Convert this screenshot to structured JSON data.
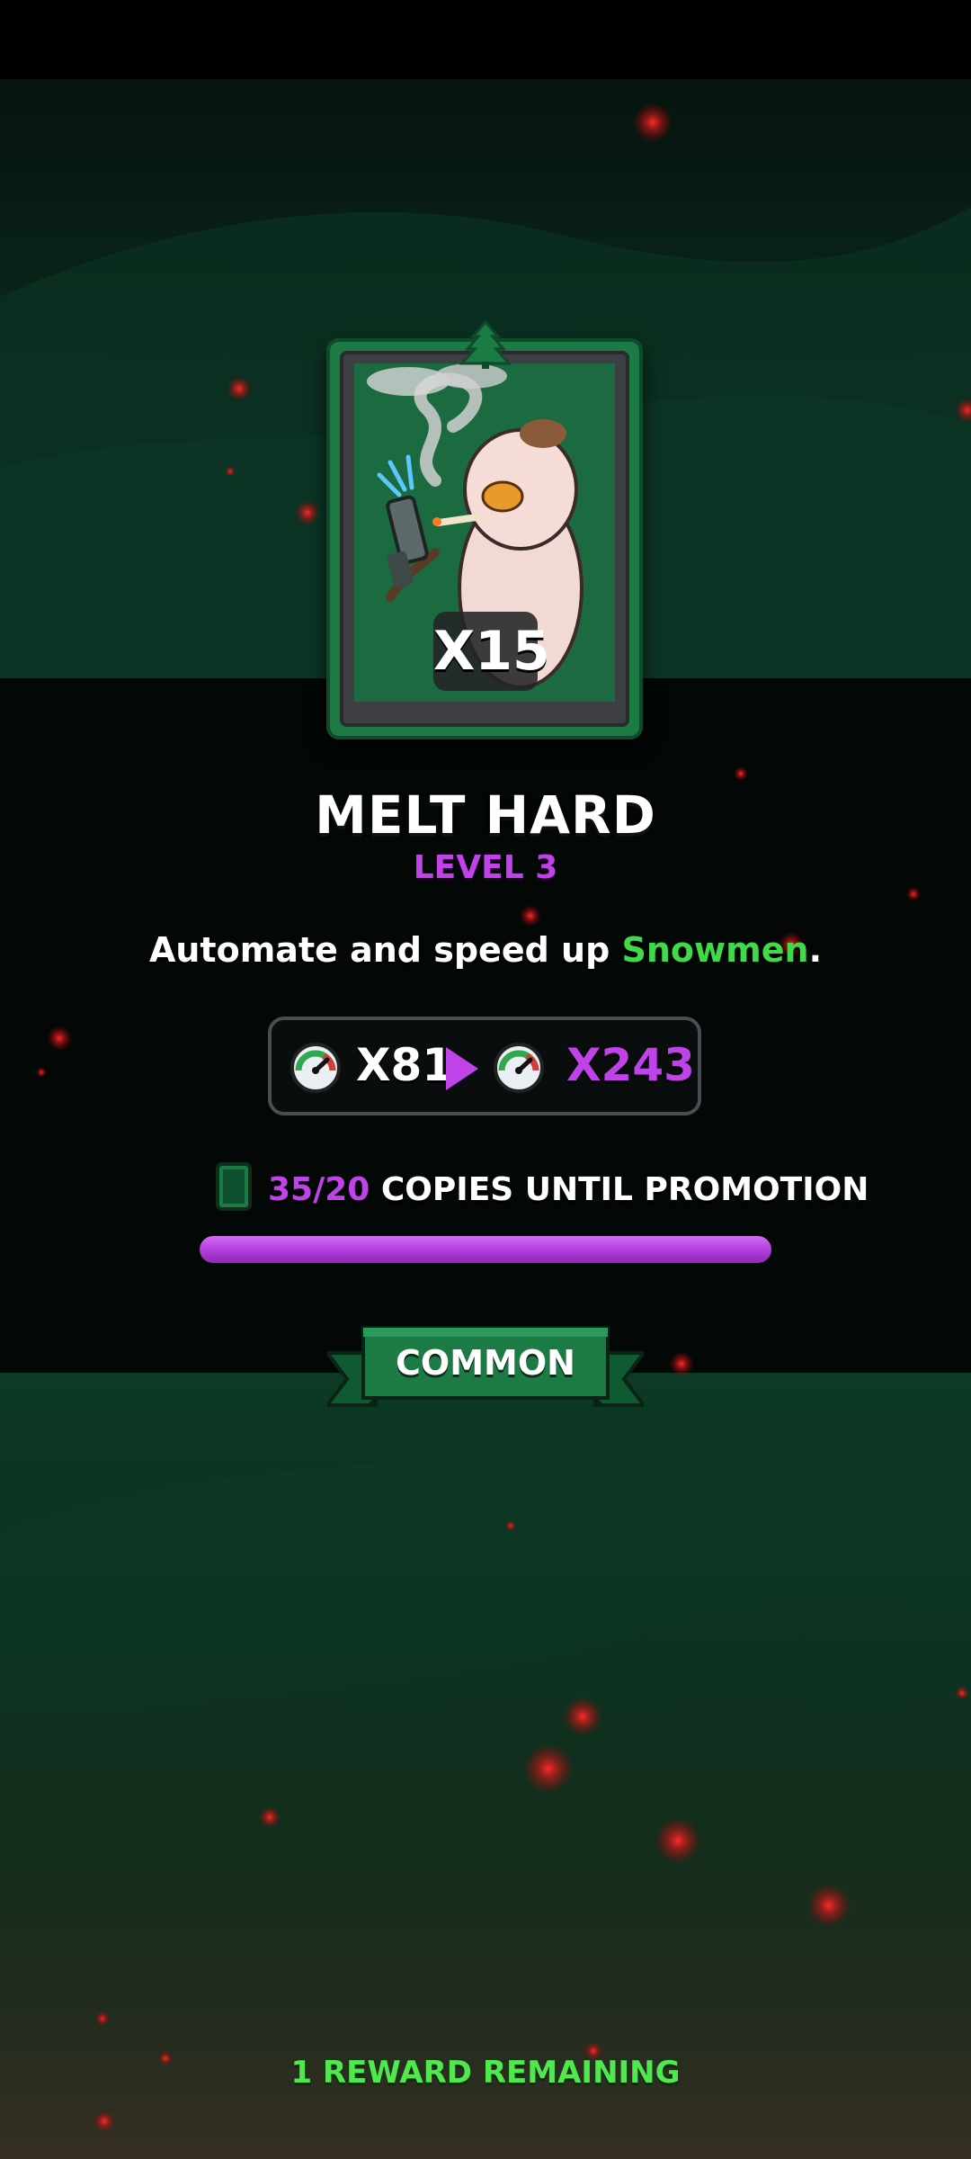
{
  "card": {
    "count": "X15",
    "name": "MELT HARD",
    "level": "LEVEL 3",
    "description_prefix": "Automate and speed up ",
    "description_highlight": "Snowmen",
    "description_suffix": ".",
    "art_icon": "snowman-smoking-gun-art",
    "tree_icon": "pine-tree-icon"
  },
  "speed": {
    "icon": "speedometer-icon",
    "from": "X81",
    "to": "X243",
    "arrow_icon": "play-arrow-icon"
  },
  "promotion": {
    "icon": "card-copy-icon",
    "count": "35/20",
    "label": "COPIES UNTIL PROMOTION",
    "progress": 1.0
  },
  "rarity": {
    "label": "COMMON",
    "color": "#1c7a45"
  },
  "footer": {
    "text": "1 REWARD REMAINING"
  },
  "colors": {
    "accent_purple": "#c043ea",
    "accent_green": "#3fd94a",
    "card_green": "#1c7a45"
  }
}
